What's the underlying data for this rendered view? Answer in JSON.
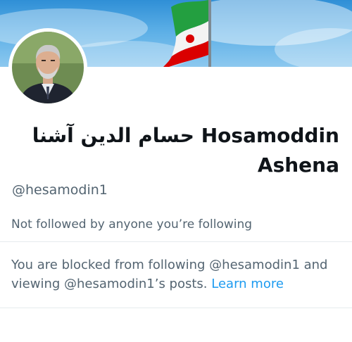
{
  "profile": {
    "display_name_line1": "حسام الدين آشنا Hosamoddin",
    "display_name_line2": "Ashena",
    "handle": "@hesamodin1",
    "follow_note": "Not followed by anyone you’re following"
  },
  "blocked_notice": {
    "text_part1": "You are blocked from following @hesamodin1 and viewing @hesamodin1’s posts.",
    "learn_more": "Learn more"
  },
  "colors": {
    "link": "#1d9bf0",
    "secondary_text": "#536471",
    "primary_text": "#0f1419",
    "flag_green": "#239f40",
    "flag_red": "#da0000"
  },
  "icons": {
    "avatar": "profile-photo",
    "banner": "banner-image-flag"
  }
}
